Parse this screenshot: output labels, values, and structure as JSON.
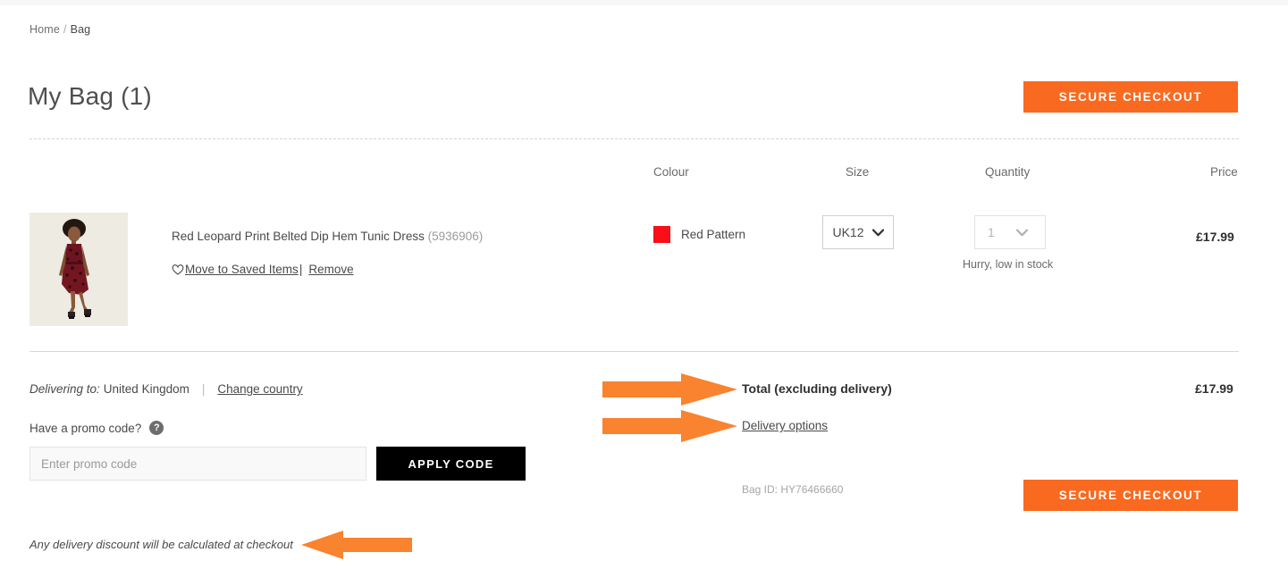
{
  "breadcrumb": {
    "home": "Home",
    "separator": "/",
    "current": "Bag"
  },
  "header": {
    "title": "My Bag (1)",
    "checkout_label": "SECURE CHECKOUT"
  },
  "table": {
    "columns": {
      "colour": "Colour",
      "size": "Size",
      "quantity": "Quantity",
      "price": "Price"
    }
  },
  "item": {
    "name": "Red Leopard Print Belted Dip Hem Tunic Dress",
    "sku": "(5936906)",
    "save_link": "Move to Saved Items",
    "separator": "|",
    "remove_link": "Remove",
    "colour_name": "Red Pattern",
    "colour_hex": "#f80f18",
    "size_value": "UK12",
    "quantity_value": "1",
    "stock_note": "Hurry, low in stock",
    "price": "£17.99"
  },
  "delivery": {
    "delivering_label": "Delivering to:",
    "country": "United Kingdom",
    "pipe": "|",
    "change_country": "Change country"
  },
  "promo": {
    "label": "Have a promo code?",
    "help_glyph": "?",
    "placeholder": "Enter promo code",
    "value": "",
    "apply_label": "APPLY CODE"
  },
  "totals": {
    "total_label": "Total (excluding delivery)",
    "total_value": "£17.99",
    "delivery_options": "Delivery options",
    "bag_id": "Bag ID: HY76466660",
    "checkout_label": "SECURE CHECKOUT"
  },
  "footnote": "Any delivery discount will be calculated at checkout",
  "colors": {
    "accent_orange": "#f96a20",
    "arrow_orange": "#f9832f",
    "apply_black": "#000000"
  }
}
